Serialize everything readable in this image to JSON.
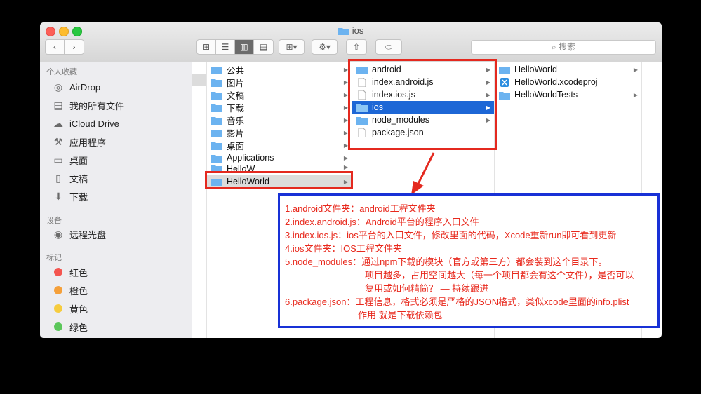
{
  "window": {
    "title": "ios"
  },
  "toolbar": {
    "search_placeholder": "搜索"
  },
  "sidebar": {
    "favorites_header": "个人收藏",
    "favorites": [
      {
        "label": "AirDrop",
        "icon": "airdrop-icon"
      },
      {
        "label": "我的所有文件",
        "icon": "all-files-icon"
      },
      {
        "label": "iCloud Drive",
        "icon": "cloud-icon"
      },
      {
        "label": "应用程序",
        "icon": "applications-icon"
      },
      {
        "label": "桌面",
        "icon": "desktop-icon"
      },
      {
        "label": "文稿",
        "icon": "documents-icon"
      },
      {
        "label": "下载",
        "icon": "download-icon"
      }
    ],
    "devices_header": "设备",
    "devices": [
      {
        "label": "远程光盘",
        "icon": "disc-icon"
      }
    ],
    "tags_header": "标记",
    "tags": [
      {
        "label": "红色",
        "color": "#f4554f"
      },
      {
        "label": "橙色",
        "color": "#f5a03a"
      },
      {
        "label": "黄色",
        "color": "#f6cc3e"
      },
      {
        "label": "绿色",
        "color": "#5bc65a"
      }
    ]
  },
  "columns": {
    "col1": [
      "公共",
      "图片",
      "文稿",
      "下载",
      "音乐",
      "影片",
      "桌面",
      "Applications",
      "HelloW",
      "HelloWorld"
    ],
    "col2": [
      "android",
      "index.android.js",
      "index.ios.js",
      "ios",
      "node_modules",
      "package.json"
    ],
    "col3": [
      "HelloWorld",
      "HelloWorld.xcodeproj",
      "HelloWorldTests"
    ]
  },
  "notes": [
    "1.android文件夹：android工程文件夹",
    "2.index.android.js：Android平台的程序入口文件",
    "3.index.ios.js：ios平台的入口文件，修改里面的代码，Xcode重新run即可看到更新",
    "4.ios文件夹：IOS工程文件夹",
    "5.node_modules：通过npm下载的模块（官方或第三方）都会装到这个目录下。",
    "项目越多，占用空间越大（每一个项目都会有这个文件），是否可以",
    "复用或如何精简？ — 持续跟进",
    "6.package.json：工程信息，格式必须是严格的JSON格式，类似xcode里面的info.plist",
    "作用 就是下载依赖包"
  ],
  "colors": {
    "selection": "#1d67d6",
    "annotation_red": "#e4291f",
    "annotation_blue": "#1831d6"
  }
}
